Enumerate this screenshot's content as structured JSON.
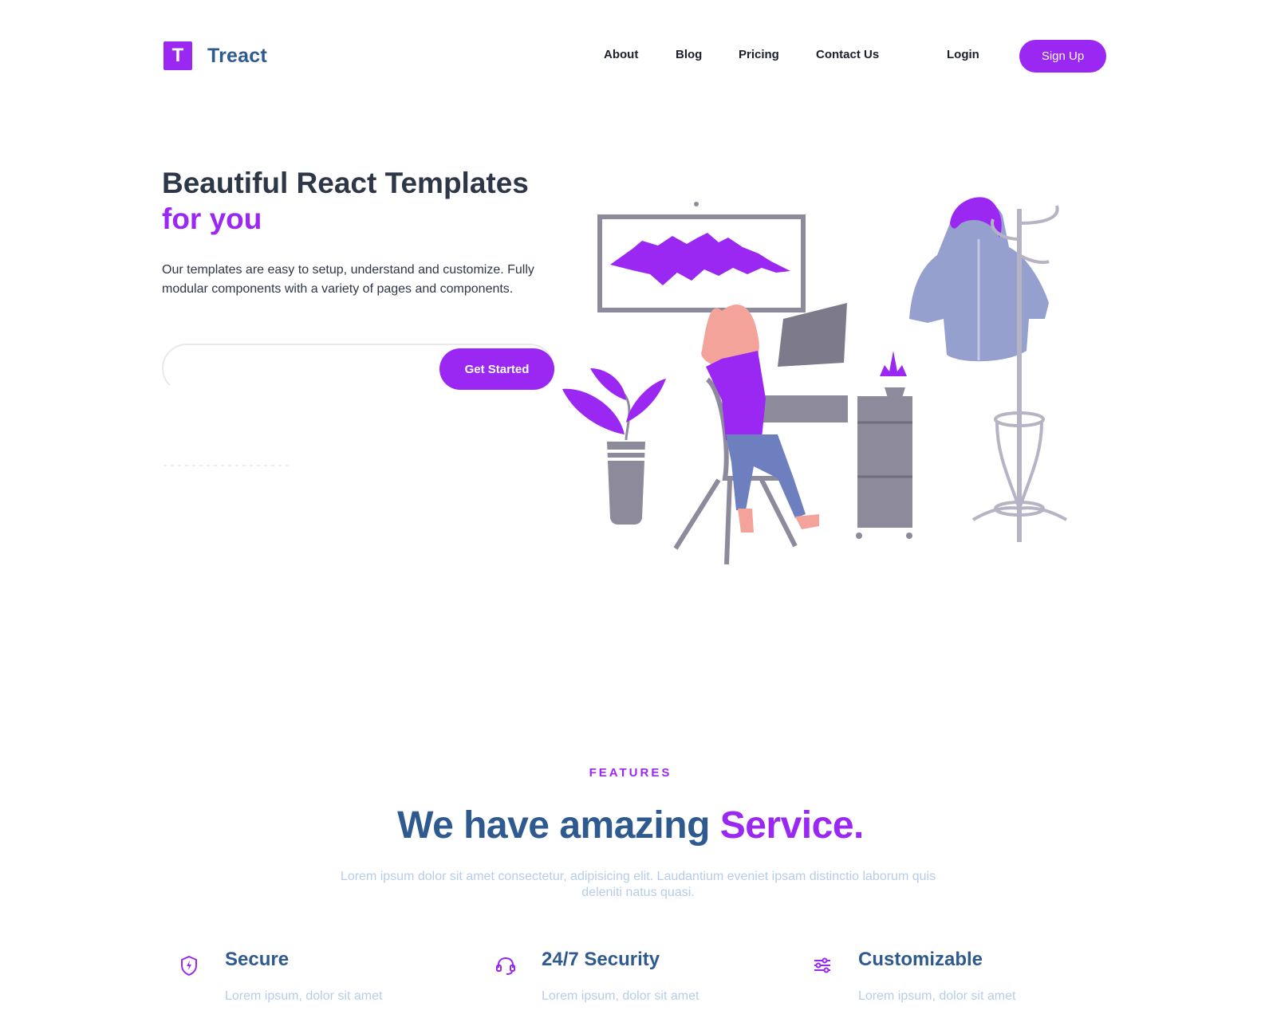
{
  "brand": {
    "mark": "T",
    "name": "Treact",
    "accent_color": "#9b27f2",
    "text_color": "#2f5a8f"
  },
  "nav": {
    "links": [
      "About",
      "Blog",
      "Pricing",
      "Contact Us"
    ],
    "login": "Login",
    "signup": "Sign Up"
  },
  "hero": {
    "title_line1": "Beautiful React Templates",
    "title_line2": "for you",
    "description": "Our templates are easy to setup, understand and customize. Fully modular components with a variety of pages and components.",
    "email_placeholder": "",
    "cta": "Get Started"
  },
  "features": {
    "subheading": "FEATURES",
    "title_main": "We have amazing ",
    "title_accent": "Service.",
    "description": "Lorem ipsum dolor sit amet consectetur, adipisicing elit. Laudantium eveniet ipsam distinctio laborum quis deleniti natus quasi.",
    "items": [
      {
        "icon": "shield-icon",
        "title": "Secure",
        "desc": "Lorem ipsum, dolor sit amet"
      },
      {
        "icon": "headset-icon",
        "title": "24/7 Security",
        "desc": "Lorem ipsum, dolor sit amet"
      },
      {
        "icon": "sliders-icon",
        "title": "Customizable",
        "desc": "Lorem ipsum, dolor sit amet"
      }
    ]
  }
}
